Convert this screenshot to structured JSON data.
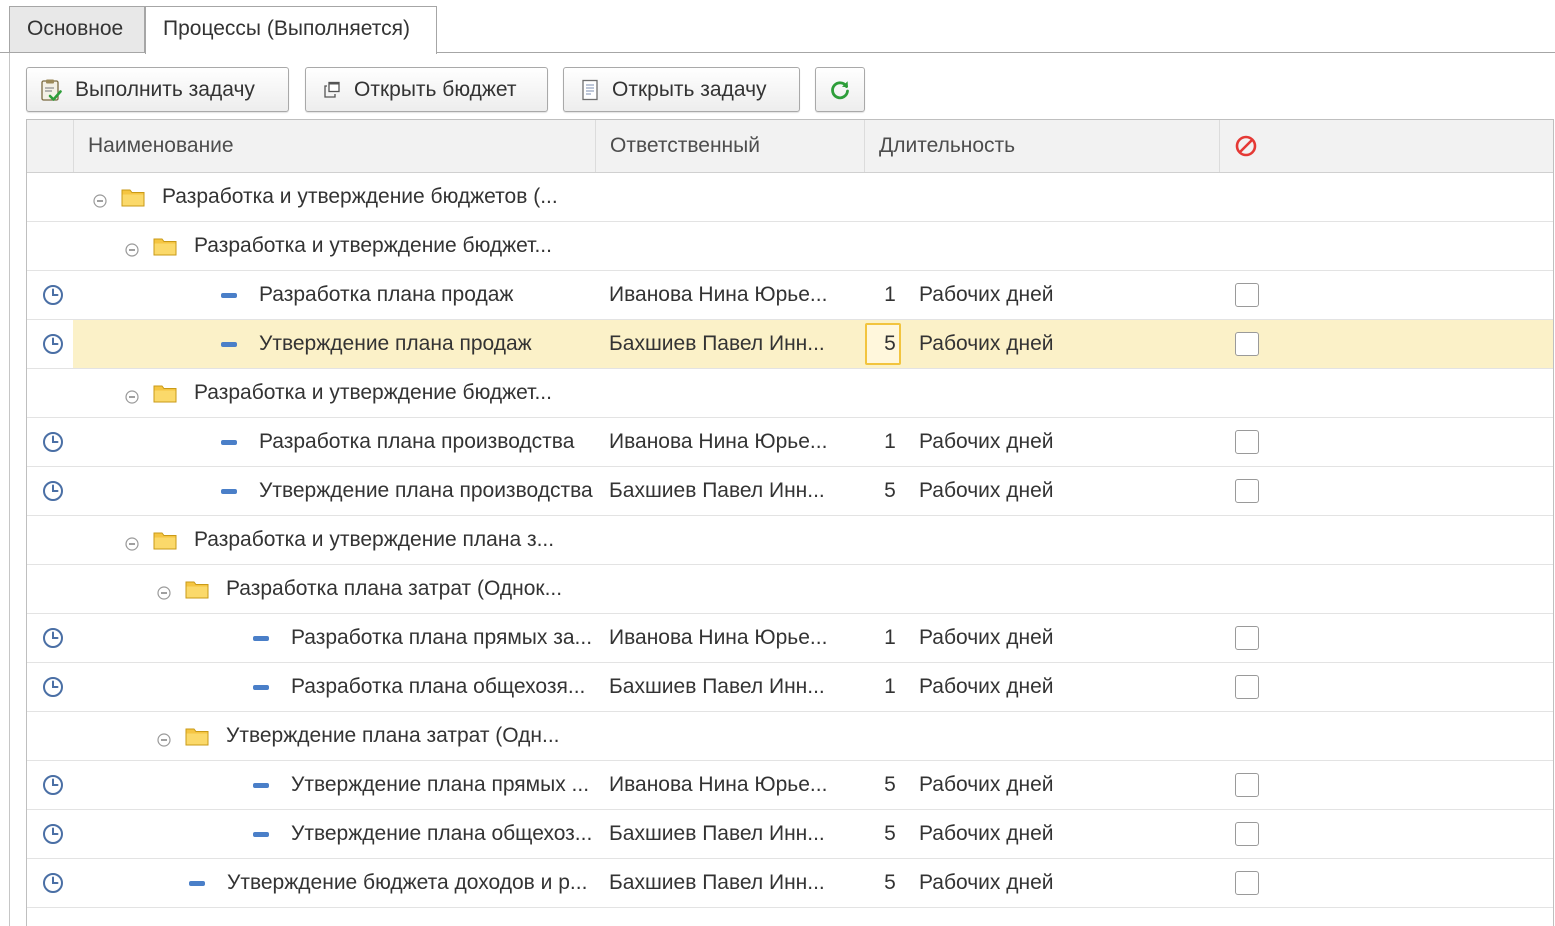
{
  "tabs": [
    {
      "label": "Основное",
      "active": false
    },
    {
      "label": "Процессы (Выполняется)",
      "active": true
    }
  ],
  "toolbar": {
    "execute_task_label": "Выполнить задачу",
    "open_budget_label": "Открыть бюджет",
    "open_task_label": "Открыть задачу",
    "refresh_icon": "refresh-icon",
    "refresh_color": "#2e9e3a"
  },
  "table": {
    "columns": {
      "name": "Наименование",
      "responsible": "Ответственный",
      "duration": "Длительность",
      "cancel_icon": "prohibited-icon"
    },
    "colors": {
      "cancel_icon": "#e53935",
      "selected_row": "#fbf1c8",
      "folder": "#f5c542",
      "task_dash": "#4a7fc8"
    },
    "rows": [
      {
        "type": "group",
        "level": 0,
        "name": "Разработка и утверждение бюджетов (..."
      },
      {
        "type": "group",
        "level": 1,
        "name": "Разработка и утверждение бюджет..."
      },
      {
        "type": "task",
        "level": 2,
        "name": "Разработка плана продаж",
        "responsible": "Иванова Нина Юрье...",
        "duration": "1",
        "unit": "Рабочих дней",
        "checked": false
      },
      {
        "type": "task",
        "level": 2,
        "name": "Утверждение плана продаж",
        "responsible": "Бахшиев Павел Инн...",
        "duration": "5",
        "unit": "Рабочих дней",
        "checked": false,
        "selected": true
      },
      {
        "type": "group",
        "level": 1,
        "name": "Разработка и утверждение бюджет..."
      },
      {
        "type": "task",
        "level": 2,
        "name": "Разработка плана производства",
        "responsible": "Иванова Нина Юрье...",
        "duration": "1",
        "unit": "Рабочих дней",
        "checked": false
      },
      {
        "type": "task",
        "level": 2,
        "name": "Утверждение плана производства",
        "responsible": "Бахшиев Павел Инн...",
        "duration": "5",
        "unit": "Рабочих дней",
        "checked": false
      },
      {
        "type": "group",
        "level": 1,
        "name": "Разработка и утверждение плана з..."
      },
      {
        "type": "group",
        "level": 2,
        "name": "Разработка плана затрат (Однок..."
      },
      {
        "type": "task",
        "level": 3,
        "name": "Разработка плана прямых за...",
        "responsible": "Иванова Нина Юрье...",
        "duration": "1",
        "unit": "Рабочих дней",
        "checked": false
      },
      {
        "type": "task",
        "level": 3,
        "name": "Разработка плана общехозя...",
        "responsible": "Бахшиев Павел Инн...",
        "duration": "1",
        "unit": "Рабочих дней",
        "checked": false
      },
      {
        "type": "group",
        "level": 2,
        "name": "Утверждение плана затрат (Одн..."
      },
      {
        "type": "task",
        "level": 3,
        "name": "Утверждение плана прямых ...",
        "responsible": "Иванова Нина Юрье...",
        "duration": "5",
        "unit": "Рабочих дней",
        "checked": false
      },
      {
        "type": "task",
        "level": 3,
        "name": "Утверждение плана общехоз...",
        "responsible": "Бахшиев Павел Инн...",
        "duration": "5",
        "unit": "Рабочих дней",
        "checked": false
      },
      {
        "type": "task",
        "level": 1,
        "name": "Утверждение бюджета доходов и р...",
        "responsible": "Бахшиев Павел Инн...",
        "duration": "5",
        "unit": "Рабочих дней",
        "checked": false
      }
    ]
  }
}
